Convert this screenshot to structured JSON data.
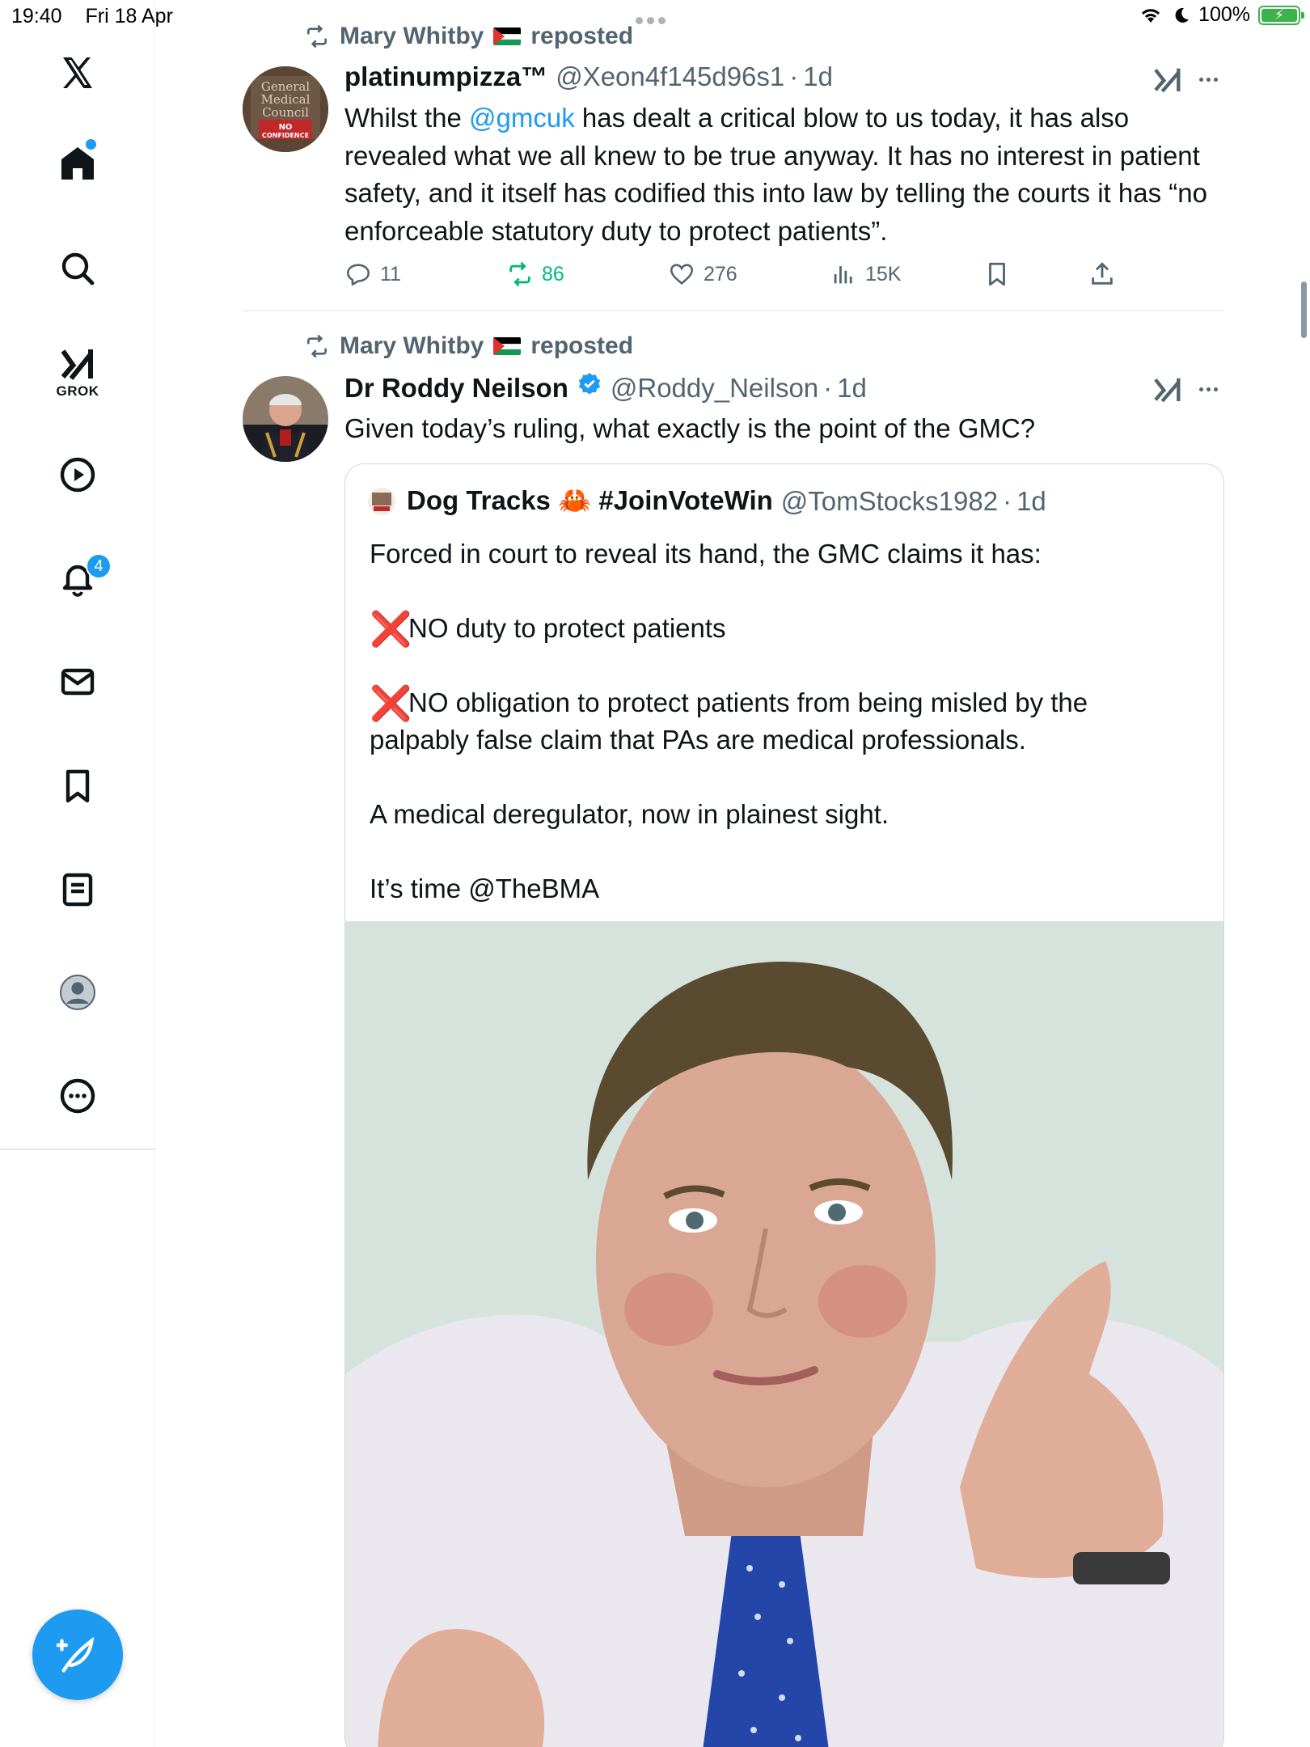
{
  "status_bar": {
    "time": "19:40",
    "date": "Fri 18 Apr",
    "battery": "100%"
  },
  "sidebar": {
    "grok_label": "GROK",
    "notifications_badge": "4",
    "icons": [
      "x-logo-icon",
      "home-icon",
      "search-icon",
      "grok-icon",
      "video-icon",
      "bell-icon",
      "mail-icon",
      "bookmark-icon",
      "lists-icon",
      "profile-icon",
      "more-icon"
    ]
  },
  "tweets": [
    {
      "repost_by": "Mary Whitby",
      "repost_suffix": "reposted",
      "name": "platinumpizza™",
      "handle": "@Xeon4f145d96s1",
      "sep": "·",
      "time": "1d",
      "text_pre": "Whilst the ",
      "mention": "@gmcuk",
      "text_post": " has dealt a critical blow to us today, it has also revealed what we all knew to be true anyway. It has no interest in patient safety, and it itself has codified this into law by telling the courts it has “no enforceable statutory duty to protect patients”.",
      "avatar_text": [
        "General",
        "Medical",
        "Council",
        "NO",
        "CONFIDENCE"
      ],
      "stats": {
        "replies": "11",
        "reposts": "86",
        "likes": "276",
        "views": "15K"
      }
    },
    {
      "repost_by": "Mary Whitby",
      "repost_suffix": "reposted",
      "name": "Dr Roddy Neilson",
      "handle": "@Roddy_Neilson",
      "sep": "·",
      "time": "1d",
      "text": "Given today’s ruling, what exactly is the point of the GMC?",
      "quote": {
        "name": "Dog Tracks 🦀 #JoinVoteWin",
        "handle": "@TomStocks1982",
        "sep": "·",
        "time": "1d",
        "line1": "Forced in court to reveal its hand, the GMC claims it has:",
        "bullet_mark": "❌",
        "bullet1": "NO duty to protect patients",
        "bullet2": "NO obligation to protect patients from being misled by the palpably false claim that PAs are medical professionals.",
        "line3": "A medical deregulator, now in plainest sight.",
        "line4": "It’s time @TheBMA"
      }
    }
  ],
  "colors": {
    "accent": "#1d9bf0",
    "repost_green": "#00ba7c",
    "muted": "#536471",
    "x_red": "#dd2e44"
  }
}
